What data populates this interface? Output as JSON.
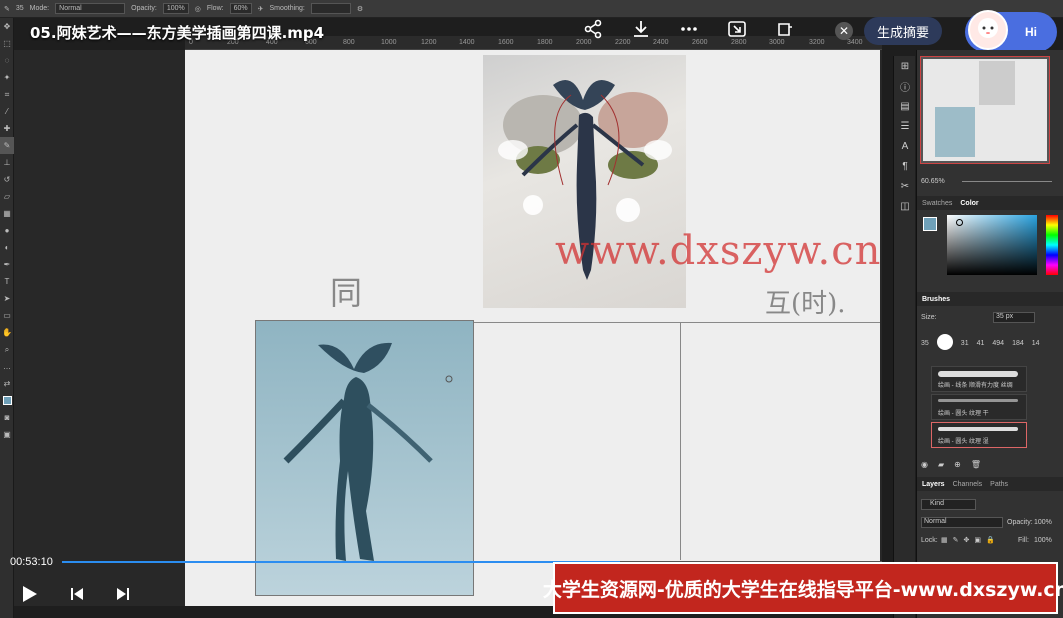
{
  "options_bar": {
    "mode_label": "Mode:",
    "mode_value": "Normal",
    "opacity_label": "Opacity:",
    "opacity_value": "100%",
    "flow_label": "Flow:",
    "flow_value": "60%",
    "smoothing_label": "Smoothing:",
    "brush_size": "35"
  },
  "video": {
    "title": "05.阿妹艺术——东方美学插画第四课.mp4",
    "summary_button": "生成摘要",
    "assistant_greeting": "Hi",
    "timecode": "00:53:10",
    "progress": 0.68
  },
  "ruler": {
    "ticks": [
      "0",
      "200",
      "400",
      "600",
      "800",
      "1000",
      "1200",
      "1400",
      "1600",
      "1800",
      "2000",
      "2200",
      "2400",
      "2600",
      "2800",
      "3000",
      "3200",
      "3400"
    ]
  },
  "canvas": {
    "watermark": "www.dxszyw.cn",
    "annotation_left": "同",
    "annotation_right": "互(时)."
  },
  "navigator": {
    "zoom": "60.65%"
  },
  "color_panel": {
    "tabs": [
      "Swatches",
      "Color"
    ],
    "active_tab": "Color",
    "foreground": "#6fa0b8",
    "background": "#ffffff"
  },
  "brushes_panel": {
    "title": "Brushes",
    "size_label": "Size:",
    "size_value": "35 px",
    "tip_sizes": [
      "35",
      "",
      "31",
      "41",
      "494",
      "184",
      "14"
    ],
    "presets": [
      "绘画 - 线条 顺滑有力度 丝绸",
      "绘画 - 圆头 纹理 干",
      "绘画 - 圆头 纹理 湿"
    ],
    "selected_preset": 2
  },
  "layers_panel": {
    "tabs": [
      "Layers",
      "Channels",
      "Paths"
    ],
    "active_tab": "Layers",
    "filter_kind": "Kind",
    "blend_mode": "Normal",
    "opacity_label": "Opacity:",
    "opacity_value": "100%",
    "lock_label": "Lock:",
    "fill_label": "Fill:",
    "fill_value": "100%"
  },
  "banner": {
    "text": "大学生资源网-优质的大学生在线指导平台-www.dxszyw.cn"
  }
}
